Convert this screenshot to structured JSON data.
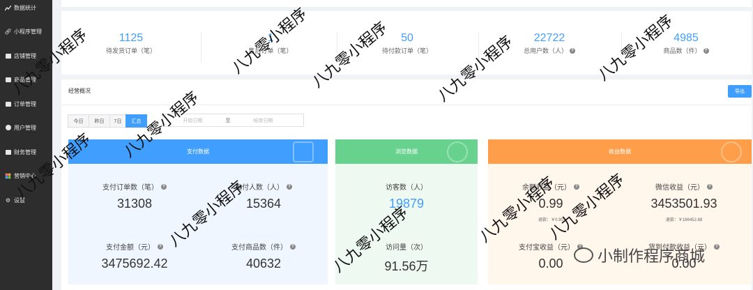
{
  "sidebar": {
    "items": [
      {
        "label": "数据统计",
        "icon": "chart-icon"
      },
      {
        "label": "小程序管理",
        "icon": "link-icon"
      },
      {
        "label": "店铺管理",
        "icon": "store-icon"
      },
      {
        "label": "商品管理",
        "icon": "goods-icon"
      },
      {
        "label": "订单管理",
        "icon": "order-icon"
      },
      {
        "label": "用户管理",
        "icon": "user-icon"
      },
      {
        "label": "财务管理",
        "icon": "finance-icon"
      },
      {
        "label": "营销中心",
        "icon": "marketing-icon"
      },
      {
        "label": "设置",
        "icon": "settings-icon"
      }
    ]
  },
  "stats": [
    {
      "value": "1125",
      "label": "待发货订单（笔）",
      "help": false
    },
    {
      "value": "1",
      "label": "售后订单（笔）",
      "help": false
    },
    {
      "value": "50",
      "label": "待付款订单（笔）",
      "help": false
    },
    {
      "value": "22722",
      "label": "总用户数（人）",
      "help": true
    },
    {
      "value": "4985",
      "label": "商品数（件）",
      "help": true
    }
  ],
  "overview": {
    "title": "经营概况",
    "export_label": "导出",
    "ranges": [
      "今日",
      "昨日",
      "7日",
      "汇总"
    ],
    "active_range": "汇总",
    "date_start_placeholder": "开始日期",
    "date_separator": "至",
    "date_end_placeholder": "结束日期"
  },
  "pay_panel": {
    "title": "支付数据",
    "color": "#409eff",
    "metrics": [
      {
        "label": "支付订单数（笔）",
        "value": "31308"
      },
      {
        "label": "支付人数（人）",
        "value": "15364"
      },
      {
        "label": "支付金额（元）",
        "value": "3475692.42"
      },
      {
        "label": "支付商品数（件）",
        "value": "40632"
      }
    ]
  },
  "browse_panel": {
    "title": "浏览数据",
    "color": "#67d18e",
    "metrics": [
      {
        "label": "访客数（人）",
        "value": "19879"
      },
      {
        "label": "访问量（次）",
        "value": "91.56万"
      }
    ]
  },
  "income_panel": {
    "title": "收益数据",
    "color": "#ff9e4a",
    "metrics": [
      {
        "label": "余额收益（元）",
        "value": "0.99",
        "refund": "退款：￥0.90"
      },
      {
        "label": "微信收益（元）",
        "value": "3453501.93",
        "refund": "退款：￥186452.88"
      },
      {
        "label": "支付宝收益（元）",
        "value": "0.00"
      },
      {
        "label": "货到付款收益（元）",
        "value": "0.00"
      }
    ]
  },
  "watermark": {
    "text": "八九零小程序",
    "brand": "小制作程序商城"
  }
}
